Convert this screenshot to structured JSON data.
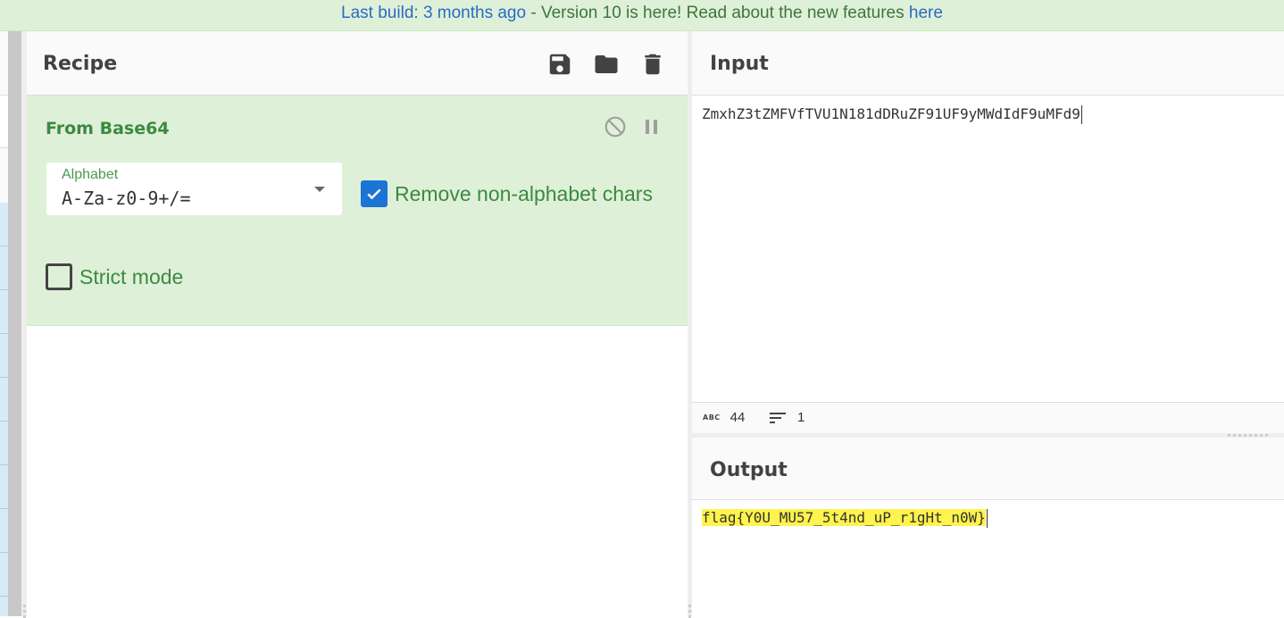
{
  "banner": {
    "last_build": "Last build: 3 months ago",
    "separator": " - ",
    "message": "Version 10 is here! Read about the new features ",
    "link": "here"
  },
  "recipe": {
    "title": "Recipe",
    "header_icons": [
      "save-icon",
      "folder-icon",
      "trash-icon"
    ],
    "operation": {
      "name": "From Base64",
      "controls": [
        "disable-icon",
        "pause-icon"
      ],
      "alphabet": {
        "label": "Alphabet",
        "value": "A-Za-z0-9+/="
      },
      "remove_non_alphabet": {
        "label": "Remove non-alphabet chars",
        "checked": true
      },
      "strict_mode": {
        "label": "Strict mode",
        "checked": false
      }
    }
  },
  "input": {
    "title": "Input",
    "text": "ZmxhZ3tZMFVfTVU1N181dDRuZF91UF9yMWdIdF9uMFd9",
    "stats": {
      "length_icon": "ABC",
      "length": "44",
      "lines": "1"
    }
  },
  "output": {
    "title": "Output",
    "text": "flag{Y0U_MU57_5t4nd_uP_r1gHt_n0W}"
  },
  "colors": {
    "banner_bg": "#dff0d8",
    "operation_bg": "#dff0d8",
    "operation_text": "#3b8a42",
    "link": "#2a6bc2",
    "checkbox_checked": "#1b74d6",
    "output_highlight": "#fff34d"
  }
}
